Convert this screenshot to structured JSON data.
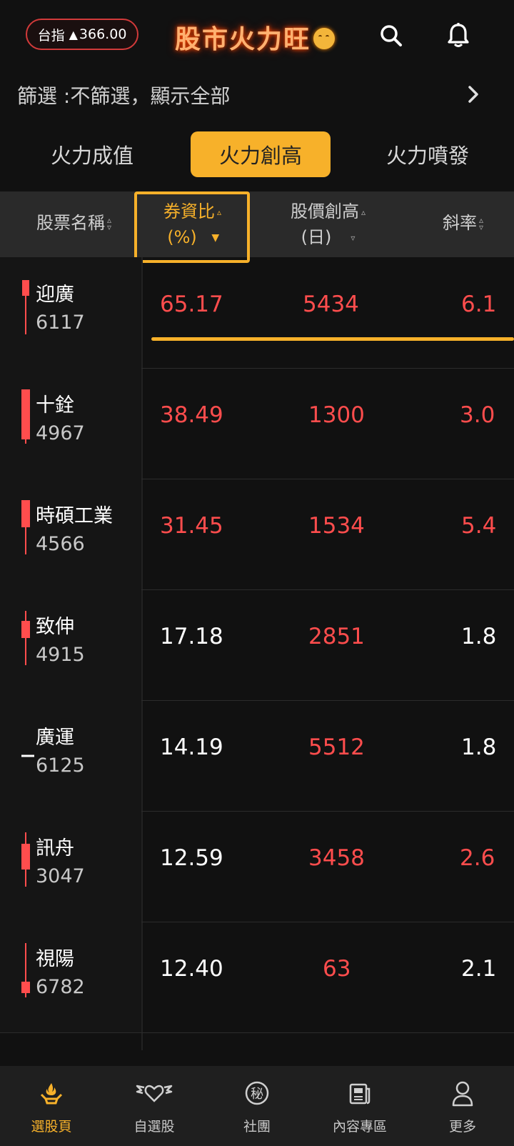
{
  "index": {
    "label": "台指",
    "arrow": "▲",
    "value": "366.00"
  },
  "app_title": "股市火力旺",
  "filter_text": "篩選 :不篩選，顯示全部",
  "tabs": [
    {
      "label": "火力成值"
    },
    {
      "label": "火力創高"
    },
    {
      "label": "火力噴發"
    }
  ],
  "active_tab": 1,
  "columns": {
    "name": "股票名稱",
    "ratio_line1": "券資比",
    "ratio_line2": "(%)",
    "high_line1": "股價創高",
    "high_line2": "(日)",
    "slope": "斜率"
  },
  "rows": [
    {
      "name": "迎廣",
      "code": "6117",
      "ratio": "65.17",
      "high": "5434",
      "slope": "6.1",
      "ratio_color": "red",
      "high_color": "red",
      "slope_color": "red",
      "candle": "up-thin"
    },
    {
      "name": "十銓",
      "code": "4967",
      "ratio": "38.49",
      "high": "1300",
      "slope": "3.0",
      "ratio_color": "red",
      "high_color": "red",
      "slope_color": "red",
      "candle": "up-tall"
    },
    {
      "name": "時碩工業",
      "code": "4566",
      "ratio": "31.45",
      "high": "1534",
      "slope": "5.4",
      "ratio_color": "red",
      "high_color": "red",
      "slope_color": "red",
      "candle": "up-mid"
    },
    {
      "name": "致伸",
      "code": "4915",
      "ratio": "17.18",
      "high": "2851",
      "slope": "1.8",
      "ratio_color": "white",
      "high_color": "red",
      "slope_color": "white",
      "candle": "up-small"
    },
    {
      "name": "廣運",
      "code": "6125",
      "ratio": "14.19",
      "high": "5512",
      "slope": "1.8",
      "ratio_color": "white",
      "high_color": "red",
      "slope_color": "white",
      "candle": "flat"
    },
    {
      "name": "訊舟",
      "code": "3047",
      "ratio": "12.59",
      "high": "3458",
      "slope": "2.6",
      "ratio_color": "white",
      "high_color": "red",
      "slope_color": "red",
      "candle": "up-mid2"
    },
    {
      "name": "視陽",
      "code": "6782",
      "ratio": "12.40",
      "high": "63",
      "slope": "2.1",
      "ratio_color": "white",
      "high_color": "red",
      "slope_color": "white",
      "candle": "down-bottom"
    }
  ],
  "bottom_nav": [
    {
      "label": "選股頁",
      "icon": "hand-flame-icon"
    },
    {
      "label": "自選股",
      "icon": "winged-heart-icon"
    },
    {
      "label": "社團",
      "icon": "secret-badge-icon",
      "glyph": "秘"
    },
    {
      "label": "內容專區",
      "icon": "newspaper-icon"
    },
    {
      "label": "更多",
      "icon": "person-icon"
    }
  ],
  "colors": {
    "accent": "#f7b12a",
    "up": "#ff4d4d",
    "down": "#ffffff"
  }
}
